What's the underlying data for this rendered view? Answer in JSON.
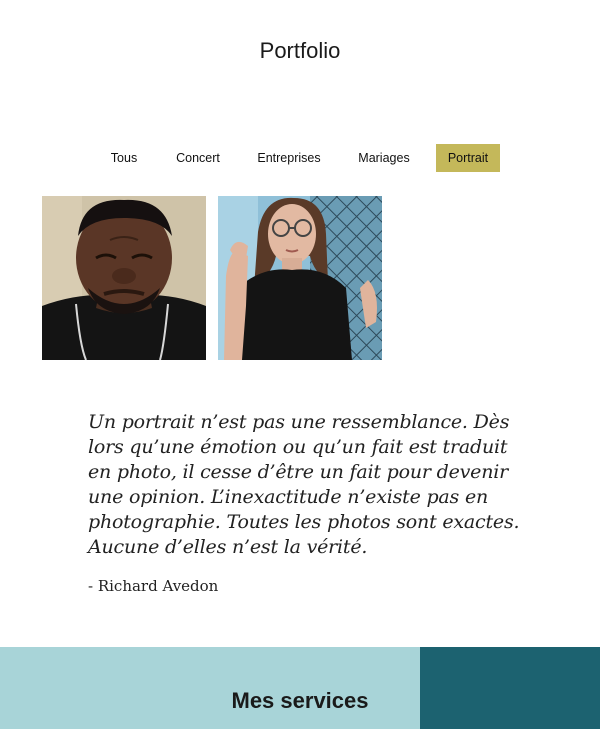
{
  "header": {
    "title": "Portfolio"
  },
  "filters": {
    "items": [
      {
        "label": "Tous"
      },
      {
        "label": "Concert"
      },
      {
        "label": "Entreprises"
      },
      {
        "label": "Mariages"
      },
      {
        "label": "Portrait"
      }
    ],
    "active": "Portrait",
    "active_color": "#c4b85a"
  },
  "gallery": {
    "photos": [
      {
        "subject": "portrait-man-eyes-closed"
      },
      {
        "subject": "portrait-woman-glasses-fence"
      }
    ]
  },
  "quote": {
    "text": "Un portrait n’est pas une ressemblance. Dès lors qu’une émotion ou qu’un fait est traduit en photo, il cesse d’être un fait pour devenir une opinion. L’inexactitude n’existe pas en photographie. Toutes les photos sont exactes. Aucune d’elles n’est la vérité.",
    "author": "- Richard Avedon"
  },
  "services": {
    "title": "Mes services",
    "color_left": "#a8d4d8",
    "color_right": "#1c6270"
  }
}
